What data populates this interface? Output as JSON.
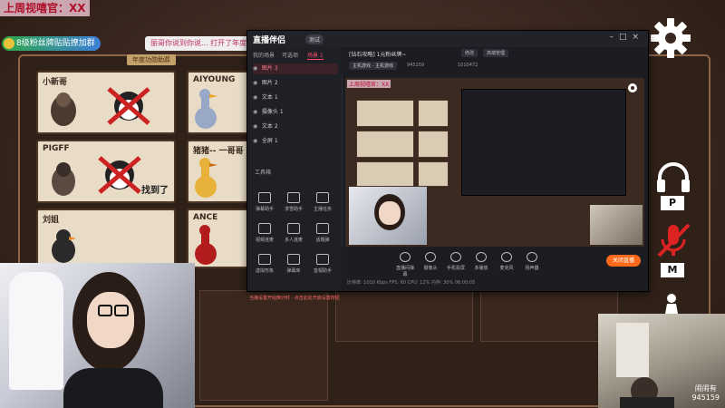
{
  "overlay": {
    "top_left_label": "上周视嘻官：XX",
    "fan_banner": "8级粉丝牌贴贴撩加群",
    "event_banner": "丽哥你说到你说... 打开了年度功勋助...",
    "event_sub": "年度功勋助葬"
  },
  "game": {
    "cards": [
      {
        "name": "小新哥",
        "found": ""
      },
      {
        "name": "AIYOUNG",
        "found": ""
      },
      {
        "name": "PIGFF",
        "found": "找到了"
      },
      {
        "name": "猪猪-- 一哥哥",
        "found": ""
      },
      {
        "name": "刘姐",
        "found": ""
      },
      {
        "name": "ANCE",
        "found": ""
      }
    ],
    "tags": {
      "p": "P",
      "m": "M"
    }
  },
  "app": {
    "logo": "直播伴侣",
    "version": "测试",
    "left_tabs": [
      "我的场景",
      "可选项",
      "场景 1"
    ],
    "sources": [
      {
        "label": "图片 3",
        "selected": true
      },
      {
        "label": "图片 2",
        "selected": false
      },
      {
        "label": "文本 1",
        "selected": false
      },
      {
        "label": "摄像头 1",
        "selected": false
      },
      {
        "label": "文本 2",
        "selected": false
      },
      {
        "label": "全屏 1",
        "selected": false
      }
    ],
    "tools_title": "工具箱",
    "tools": [
      "弹幕助手",
      "求雪助手",
      "主播任务",
      "视频连麦",
      "多人连麦",
      "话题弹",
      "虚拟形象",
      "弹幕库",
      "音视助手"
    ],
    "notice": "当播设置开始倒计时 · 点击此处开启设置按钮",
    "room": {
      "title": "[钻石攻略] 1元粉丝牌~",
      "tag1": "修改",
      "tag2": "高端管理",
      "category": "主机游戏 - 主机游戏",
      "room_no": "945159",
      "viewers": "1010472"
    },
    "bottom_tools": [
      "直播间弹幕",
      "摄像头",
      "手机投屏",
      "多播放",
      "麦克风",
      "扬声器"
    ],
    "go_live": "关闭直播",
    "stats": "比特率: 1010 Kbps    FPS: 60    CPU: 12%    内存: 30%    06:00:05"
  },
  "preview": {
    "label": "上周视嘻官：XX"
  },
  "guest_cam": {
    "watermark_line1": "闹闹有",
    "watermark_line2": "945159"
  },
  "colors": {
    "accent": "#ff4a6a",
    "go_live": "#ff6a1a",
    "board_bg": "#3a2820",
    "card_bg": "#e9dcc7"
  }
}
